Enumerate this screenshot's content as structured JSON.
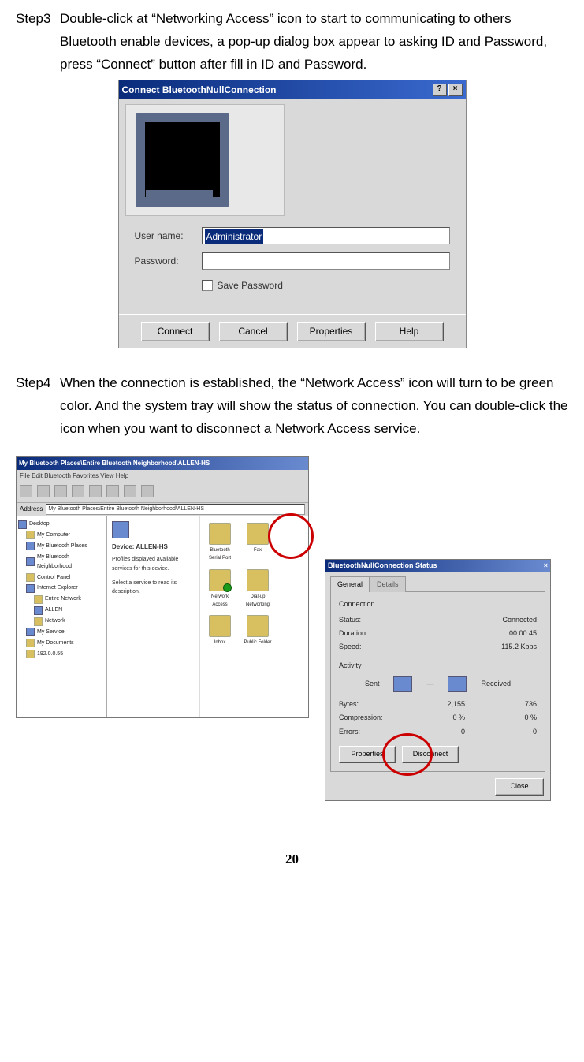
{
  "step3": {
    "label": "Step3",
    "text": "Double-click at “Networking Access” icon to start to communicating to others Bluetooth enable devices, a pop-up dialog box appear to asking ID and Password, press “Connect” button after fill in ID and Password."
  },
  "dialog1": {
    "title": "Connect BluetoothNullConnection",
    "help_btn": "?",
    "close_btn": "×",
    "user_label": "User name:",
    "user_value": "Administrator",
    "pass_label": "Password:",
    "pass_value": "",
    "save_label": "Save Password",
    "btn_connect": "Connect",
    "btn_cancel": "Cancel",
    "btn_properties": "Properties",
    "btn_help": "Help"
  },
  "step4": {
    "label": "Step4",
    "text": "When the connection is established, the “Network Access” icon will turn to be green color. And the system tray will show the status of connection. You can double-click the icon when you want to disconnect a Network Access service."
  },
  "explorer": {
    "title": "My Bluetooth Places\\Entire Bluetooth Neighborhood\\ALLEN-HS",
    "menu": "File  Edit  Bluetooth  Favorites  View  Help",
    "address_label": "Address",
    "address": "My Bluetooth Places\\Entire Bluetooth Neighborhood\\ALLEN-HS",
    "tree": {
      "items": [
        "Desktop",
        "My Computer",
        "My Bluetooth Places",
        "My Bluetooth Neighborhood",
        "Control Panel",
        "Internet Explorer",
        "Entire Network",
        "ALLEN",
        "Network",
        "My Service",
        "My Documents"
      ],
      "last": "192.0.0.55"
    },
    "info_title": "Device:  ALLEN-HS",
    "info_desc1": "Profiles displayed available services for this device.",
    "info_desc2": "Select a service to read its description.",
    "services": [
      {
        "name": "Bluetooth Serial Port"
      },
      {
        "name": "Fax"
      },
      {
        "name": "Network Access"
      },
      {
        "name": "Dial-up Networking"
      },
      {
        "name": "Inbox"
      },
      {
        "name": "Public Folder"
      }
    ]
  },
  "status": {
    "title": "BluetoothNullConnection Status",
    "close_btn": "×",
    "tab_general": "General",
    "tab_details": "Details",
    "conn_title": "Connection",
    "status_label": "Status:",
    "status_value": "Connected",
    "duration_label": "Duration:",
    "duration_value": "00:00:45",
    "speed_label": "Speed:",
    "speed_value": "115.2 Kbps",
    "activity_title": "Activity",
    "sent_label": "Sent",
    "received_label": "Received",
    "bytes_label": "Bytes:",
    "bytes_sent": "2,155",
    "bytes_recv": "736",
    "compression_label": "Compression:",
    "compression_sent": "0 %",
    "compression_recv": "0 %",
    "errors_label": "Errors:",
    "errors_sent": "0",
    "errors_recv": "0",
    "btn_properties": "Properties",
    "btn_disconnect": "Disconnect",
    "btn_close": "Close"
  },
  "page_number": "20"
}
